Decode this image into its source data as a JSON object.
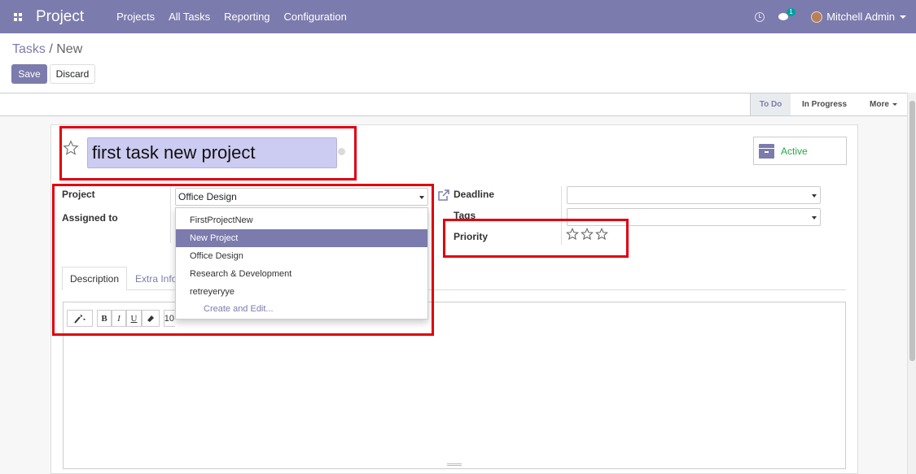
{
  "navbar": {
    "brand": "Project",
    "menu": [
      "Projects",
      "All Tasks",
      "Reporting",
      "Configuration"
    ],
    "message_count": "1",
    "user_name": "Mitchell Admin"
  },
  "breadcrumb": {
    "parent": "Tasks",
    "separator": " / ",
    "current": "New"
  },
  "buttons": {
    "save": "Save",
    "discard": "Discard"
  },
  "stages": {
    "todo": "To Do",
    "in_progress": "In Progress",
    "more": "More"
  },
  "task": {
    "title": "first task new project",
    "active_label": "Active"
  },
  "fields": {
    "project_label": "Project",
    "project_value": "Office Design",
    "assigned_label": "Assigned to",
    "deadline_label": "Deadline",
    "deadline_value": "",
    "tags_label": "Tags",
    "tags_value": "",
    "priority_label": "Priority",
    "priority_stars": 0
  },
  "tabs": {
    "description": "Description",
    "extra_info": "Extra Info"
  },
  "toolbar": {
    "bold": "B",
    "italic": "I",
    "underline": "U",
    "font_size": "10"
  },
  "dropdown": {
    "items": [
      "FirstProjectNew",
      "New Project",
      "Office Design",
      "Research & Development",
      "retreyeryye"
    ],
    "highlighted": "New Project",
    "create_edit": "Create and Edit..."
  },
  "colors": {
    "brand": "#7c7bad",
    "title_bg": "#cccbf1",
    "active_text": "#28a745",
    "highlight_box": "#e0000d"
  }
}
